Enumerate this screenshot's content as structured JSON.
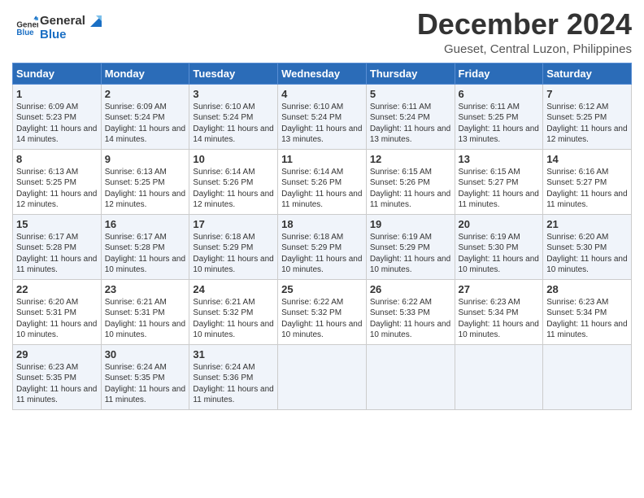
{
  "header": {
    "logo_line1": "General",
    "logo_line2": "Blue",
    "month": "December 2024",
    "location": "Gueset, Central Luzon, Philippines"
  },
  "days_of_week": [
    "Sunday",
    "Monday",
    "Tuesday",
    "Wednesday",
    "Thursday",
    "Friday",
    "Saturday"
  ],
  "weeks": [
    [
      {
        "day": "1",
        "sunrise": "6:09 AM",
        "sunset": "5:23 PM",
        "daylight": "11 hours and 14 minutes."
      },
      {
        "day": "2",
        "sunrise": "6:09 AM",
        "sunset": "5:24 PM",
        "daylight": "11 hours and 14 minutes."
      },
      {
        "day": "3",
        "sunrise": "6:10 AM",
        "sunset": "5:24 PM",
        "daylight": "11 hours and 14 minutes."
      },
      {
        "day": "4",
        "sunrise": "6:10 AM",
        "sunset": "5:24 PM",
        "daylight": "11 hours and 13 minutes."
      },
      {
        "day": "5",
        "sunrise": "6:11 AM",
        "sunset": "5:24 PM",
        "daylight": "11 hours and 13 minutes."
      },
      {
        "day": "6",
        "sunrise": "6:11 AM",
        "sunset": "5:25 PM",
        "daylight": "11 hours and 13 minutes."
      },
      {
        "day": "7",
        "sunrise": "6:12 AM",
        "sunset": "5:25 PM",
        "daylight": "11 hours and 12 minutes."
      }
    ],
    [
      {
        "day": "8",
        "sunrise": "6:13 AM",
        "sunset": "5:25 PM",
        "daylight": "11 hours and 12 minutes."
      },
      {
        "day": "9",
        "sunrise": "6:13 AM",
        "sunset": "5:25 PM",
        "daylight": "11 hours and 12 minutes."
      },
      {
        "day": "10",
        "sunrise": "6:14 AM",
        "sunset": "5:26 PM",
        "daylight": "11 hours and 12 minutes."
      },
      {
        "day": "11",
        "sunrise": "6:14 AM",
        "sunset": "5:26 PM",
        "daylight": "11 hours and 11 minutes."
      },
      {
        "day": "12",
        "sunrise": "6:15 AM",
        "sunset": "5:26 PM",
        "daylight": "11 hours and 11 minutes."
      },
      {
        "day": "13",
        "sunrise": "6:15 AM",
        "sunset": "5:27 PM",
        "daylight": "11 hours and 11 minutes."
      },
      {
        "day": "14",
        "sunrise": "6:16 AM",
        "sunset": "5:27 PM",
        "daylight": "11 hours and 11 minutes."
      }
    ],
    [
      {
        "day": "15",
        "sunrise": "6:17 AM",
        "sunset": "5:28 PM",
        "daylight": "11 hours and 11 minutes."
      },
      {
        "day": "16",
        "sunrise": "6:17 AM",
        "sunset": "5:28 PM",
        "daylight": "11 hours and 10 minutes."
      },
      {
        "day": "17",
        "sunrise": "6:18 AM",
        "sunset": "5:29 PM",
        "daylight": "11 hours and 10 minutes."
      },
      {
        "day": "18",
        "sunrise": "6:18 AM",
        "sunset": "5:29 PM",
        "daylight": "11 hours and 10 minutes."
      },
      {
        "day": "19",
        "sunrise": "6:19 AM",
        "sunset": "5:29 PM",
        "daylight": "11 hours and 10 minutes."
      },
      {
        "day": "20",
        "sunrise": "6:19 AM",
        "sunset": "5:30 PM",
        "daylight": "11 hours and 10 minutes."
      },
      {
        "day": "21",
        "sunrise": "6:20 AM",
        "sunset": "5:30 PM",
        "daylight": "11 hours and 10 minutes."
      }
    ],
    [
      {
        "day": "22",
        "sunrise": "6:20 AM",
        "sunset": "5:31 PM",
        "daylight": "11 hours and 10 minutes."
      },
      {
        "day": "23",
        "sunrise": "6:21 AM",
        "sunset": "5:31 PM",
        "daylight": "11 hours and 10 minutes."
      },
      {
        "day": "24",
        "sunrise": "6:21 AM",
        "sunset": "5:32 PM",
        "daylight": "11 hours and 10 minutes."
      },
      {
        "day": "25",
        "sunrise": "6:22 AM",
        "sunset": "5:32 PM",
        "daylight": "11 hours and 10 minutes."
      },
      {
        "day": "26",
        "sunrise": "6:22 AM",
        "sunset": "5:33 PM",
        "daylight": "11 hours and 10 minutes."
      },
      {
        "day": "27",
        "sunrise": "6:23 AM",
        "sunset": "5:34 PM",
        "daylight": "11 hours and 10 minutes."
      },
      {
        "day": "28",
        "sunrise": "6:23 AM",
        "sunset": "5:34 PM",
        "daylight": "11 hours and 11 minutes."
      }
    ],
    [
      {
        "day": "29",
        "sunrise": "6:23 AM",
        "sunset": "5:35 PM",
        "daylight": "11 hours and 11 minutes."
      },
      {
        "day": "30",
        "sunrise": "6:24 AM",
        "sunset": "5:35 PM",
        "daylight": "11 hours and 11 minutes."
      },
      {
        "day": "31",
        "sunrise": "6:24 AM",
        "sunset": "5:36 PM",
        "daylight": "11 hours and 11 minutes."
      },
      null,
      null,
      null,
      null
    ]
  ]
}
